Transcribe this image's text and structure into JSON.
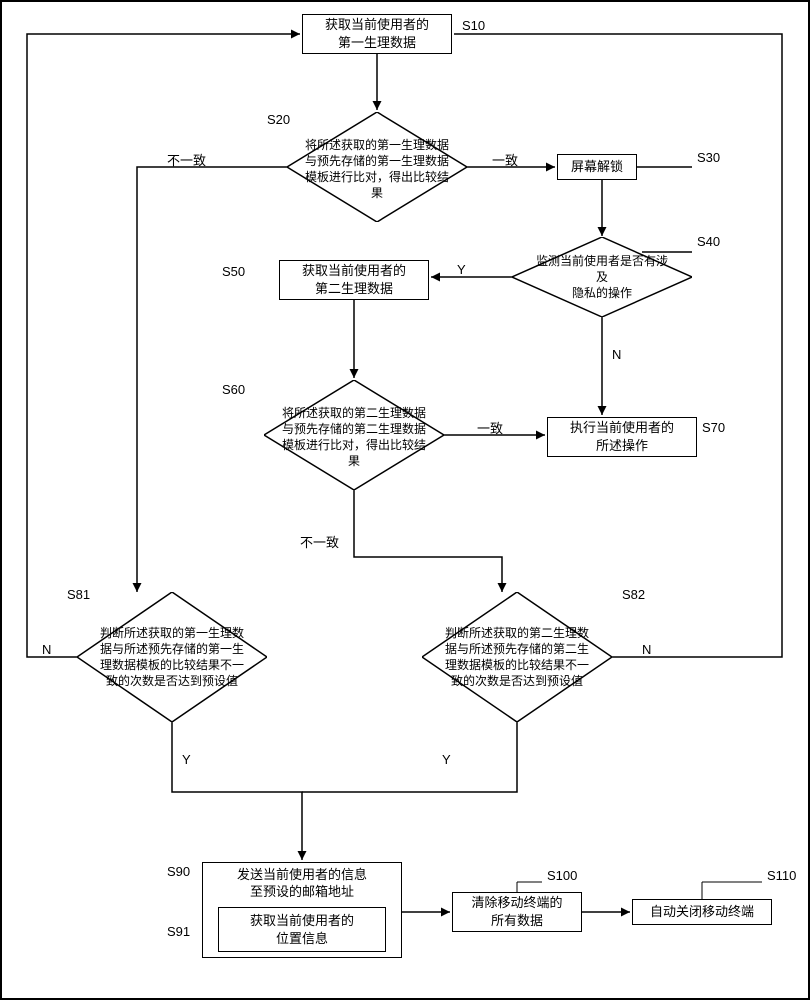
{
  "nodes": {
    "s10": {
      "id": "S10",
      "text": "获取当前使用者的\n第一生理数据"
    },
    "s20": {
      "id": "S20",
      "text": "将所述获取的第一生理数据\n与预先存储的第一生理数据\n模板进行比对，得出比较结\n果"
    },
    "s30": {
      "id": "S30",
      "text": "屏幕解锁"
    },
    "s40": {
      "id": "S40",
      "text": "监测当前使用者是否有涉及\n隐私的操作"
    },
    "s50": {
      "id": "S50",
      "text": "获取当前使用者的\n第二生理数据"
    },
    "s60": {
      "id": "S60",
      "text": "将所述获取的第二生理数据\n与预先存储的第二生理数据\n模板进行比对，得出比较结\n果"
    },
    "s70": {
      "id": "S70",
      "text": "执行当前使用者的\n所述操作"
    },
    "s81": {
      "id": "S81",
      "text": "判断所述获取的第一生理数\n据与所述预先存储的第一生\n理数据模板的比较结果不一\n致的次数是否达到预设值"
    },
    "s82": {
      "id": "S82",
      "text": "判断所述获取的第二生理数\n据与所述预先存储的第二生\n理数据模板的比较结果不一\n致的次数是否达到预设值"
    },
    "s90": {
      "id": "S90",
      "text": "发送当前使用者的信息\n至预设的邮箱地址"
    },
    "s91": {
      "id": "S91",
      "text": "获取当前使用者的\n位置信息"
    },
    "s100": {
      "id": "S100",
      "text": "清除移动终端的\n所有数据"
    },
    "s110": {
      "id": "S110",
      "text": "自动关闭移动终端"
    }
  },
  "edges": {
    "yes": "Y",
    "no": "N",
    "match": "一致",
    "nomatch": "不一致"
  }
}
